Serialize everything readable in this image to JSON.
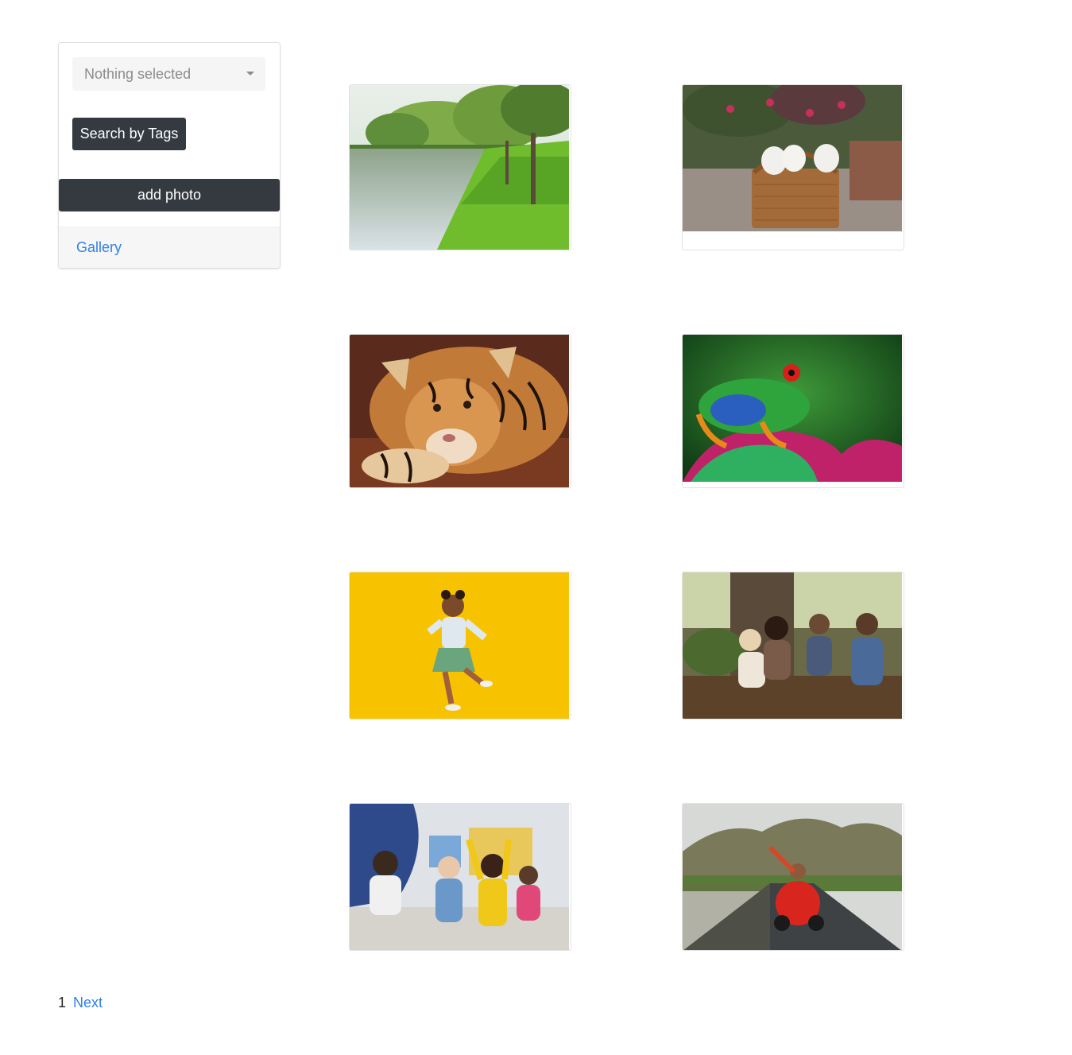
{
  "sidebar": {
    "select_placeholder": "Nothing selected",
    "search_button": "Search by Tags",
    "add_button": "add photo",
    "gallery_link": "Gallery"
  },
  "photos": [
    {
      "subject": "river-landscape"
    },
    {
      "subject": "puppies-in-basket"
    },
    {
      "subject": "tiger-cub"
    },
    {
      "subject": "tree-frog"
    },
    {
      "subject": "girl-dancing-yellow-background"
    },
    {
      "subject": "children-in-forest"
    },
    {
      "subject": "children-in-classroom"
    },
    {
      "subject": "boy-in-toy-car"
    }
  ],
  "pagination": {
    "current": "1",
    "next_label": "Next"
  },
  "colors": {
    "dark_button": "#343a40",
    "link": "#2f80e8"
  }
}
